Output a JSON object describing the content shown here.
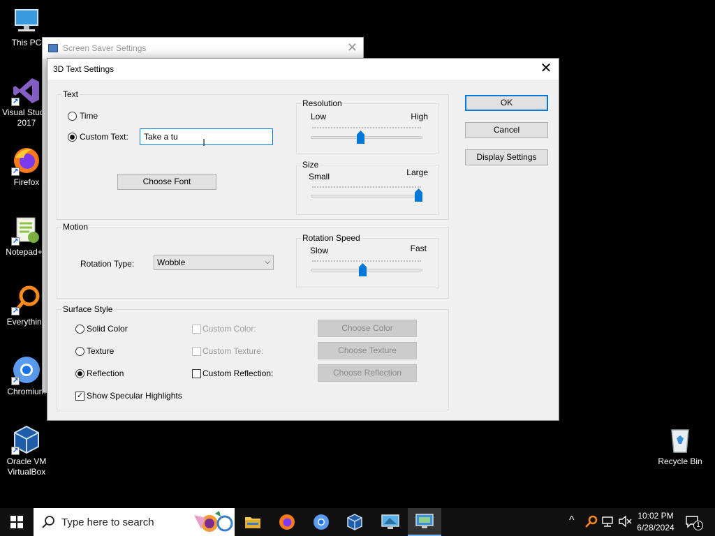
{
  "desktop": {
    "icons": [
      {
        "label": "This PC"
      },
      {
        "label": "Visual Studio 2017"
      },
      {
        "label": "Firefox"
      },
      {
        "label": "Notepad++"
      },
      {
        "label": "Everything"
      },
      {
        "label": "Chromium"
      },
      {
        "label": "Oracle VM VirtualBox"
      },
      {
        "label": "Recycle Bin"
      }
    ]
  },
  "background_window": {
    "title": "Screen Saver Settings"
  },
  "dialog": {
    "title": "3D Text Settings",
    "close": "✕",
    "text_group": {
      "label": "Text",
      "time_label": "Time",
      "custom_text_label": "Custom Text:",
      "custom_text_value": "Take a tu",
      "choose_font": "Choose Font"
    },
    "resolution": {
      "label": "Resolution",
      "low": "Low",
      "high": "High",
      "value_fraction": 0.45
    },
    "size": {
      "label": "Size",
      "small": "Small",
      "large": "Large",
      "value_fraction": 1.0
    },
    "motion": {
      "label": "Motion",
      "rotation_type_label": "Rotation Type:",
      "rotation_type_value": "Wobble"
    },
    "rotation_speed": {
      "label": "Rotation Speed",
      "slow": "Slow",
      "fast": "Fast",
      "value_fraction": 0.47
    },
    "surface": {
      "label": "Surface Style",
      "solid_color": "Solid Color",
      "texture": "Texture",
      "reflection": "Reflection",
      "custom_color": "Custom Color:",
      "custom_texture": "Custom Texture:",
      "custom_reflection": "Custom Reflection:",
      "choose_color": "Choose Color",
      "choose_texture": "Choose Texture",
      "choose_reflection": "Choose Reflection",
      "specular": "Show Specular Highlights"
    },
    "buttons": {
      "ok": "OK",
      "cancel": "Cancel",
      "display_settings": "Display Settings"
    }
  },
  "taskbar": {
    "search_placeholder": "Type here to search",
    "time": "10:02 PM",
    "date": "6/28/2024",
    "notification_count": "1"
  },
  "colors": {
    "accent": "#0078d7",
    "desktop": "#000000",
    "taskbar": "#101010"
  }
}
